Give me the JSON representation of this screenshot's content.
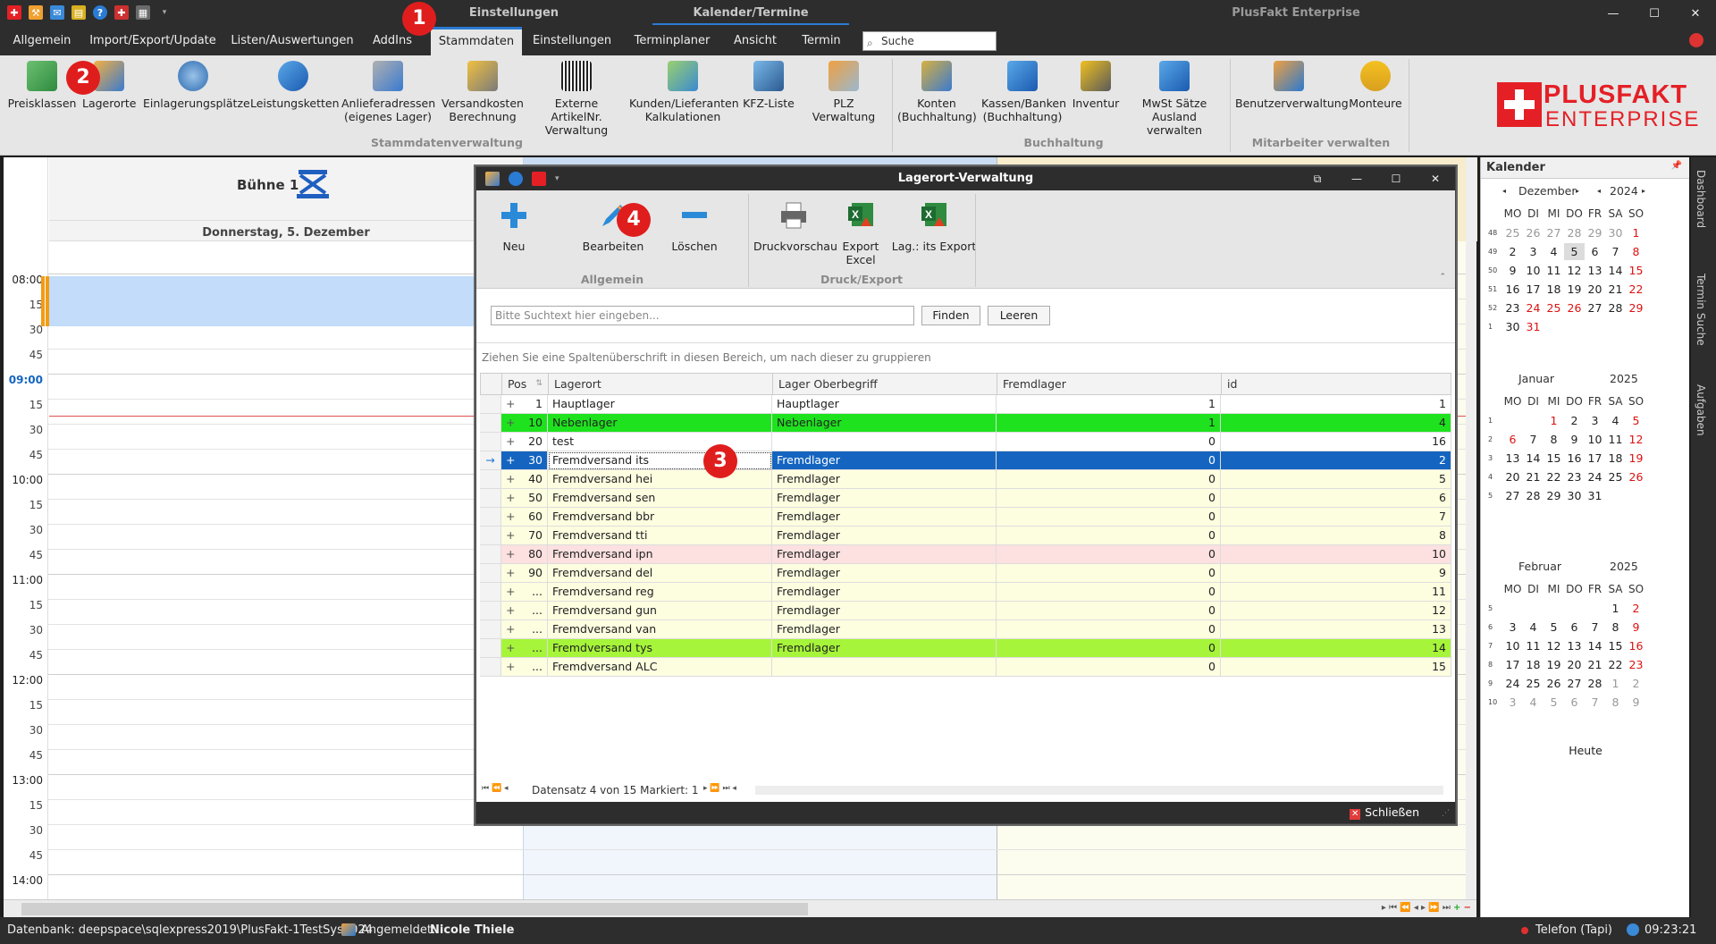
{
  "window": {
    "context_tab_1": "Einstellungen",
    "context_tab_2": "Kalender/Termine",
    "app_title": "PlusFakt Enterprise"
  },
  "menu": {
    "tabs": [
      "Allgemein",
      "Import/Export/Update",
      "Listen/Auswertungen",
      "AddIns",
      "Stammdaten",
      "Einstellungen",
      "Terminplaner",
      "Ansicht",
      "Termin"
    ],
    "active": "Stammdaten",
    "search_placeholder": "Suche"
  },
  "ribbon": {
    "buttons": [
      {
        "line1": "Preisklassen",
        "line2": ""
      },
      {
        "line1": "Lagerorte",
        "line2": ""
      },
      {
        "line1": "Einlagerungsplätze",
        "line2": ""
      },
      {
        "line1": "Leistungsketten",
        "line2": ""
      },
      {
        "line1": "Anlieferadressen",
        "line2": "(eigenes Lager)"
      },
      {
        "line1": "Versandkosten",
        "line2": "Berechnung"
      },
      {
        "line1": "Externe ArtikelNr.",
        "line2": "Verwaltung"
      },
      {
        "line1": "Kunden/Lieferanten",
        "line2": "Kalkulationen"
      },
      {
        "line1": "KFZ-Liste",
        "line2": ""
      },
      {
        "line1": "PLZ Verwaltung",
        "line2": ""
      },
      {
        "line1": "Konten",
        "line2": "(Buchhaltung)"
      },
      {
        "line1": "Kassen/Banken",
        "line2": "(Buchhaltung)"
      },
      {
        "line1": "Inventur",
        "line2": ""
      },
      {
        "line1": "MwSt Sätze",
        "line2": "Ausland verwalten"
      },
      {
        "line1": "Benutzerverwaltung",
        "line2": ""
      },
      {
        "line1": "Monteure",
        "line2": ""
      }
    ],
    "groups": [
      "Stammdatenverwaltung",
      "Buchhaltung",
      "Mitarbeiter verwalten"
    ],
    "logo_line1": "PLUSFAKT",
    "logo_line2": "ENTERPRISE"
  },
  "calendar": {
    "resource": "Bühne 1",
    "date": "Donnerstag, 5. Dezember",
    "times": [
      "08:00",
      "15",
      "30",
      "45",
      "09:00",
      "15",
      "30",
      "45",
      "10:00",
      "15",
      "30",
      "45",
      "11:00",
      "15",
      "30",
      "45",
      "12:00",
      "15",
      "30",
      "45",
      "13:00",
      "15",
      "30",
      "45",
      "14:00"
    ]
  },
  "side_calendar": {
    "title": "Kalender",
    "weekdays": [
      "MO",
      "DI",
      "MI",
      "DO",
      "FR",
      "SA",
      "SO"
    ],
    "today_button": "Heute",
    "months": [
      {
        "month": "Dezember",
        "year": "2024",
        "weeks": [
          {
            "wk": "48",
            "days": [
              "25",
              "26",
              "27",
              "28",
              "29",
              "30",
              "1"
            ]
          },
          {
            "wk": "49",
            "days": [
              "2",
              "3",
              "4",
              "5",
              "6",
              "7",
              "8"
            ]
          },
          {
            "wk": "50",
            "days": [
              "9",
              "10",
              "11",
              "12",
              "13",
              "14",
              "15"
            ]
          },
          {
            "wk": "51",
            "days": [
              "16",
              "17",
              "18",
              "19",
              "20",
              "21",
              "22"
            ]
          },
          {
            "wk": "52",
            "days": [
              "23",
              "24",
              "25",
              "26",
              "27",
              "28",
              "29"
            ]
          },
          {
            "wk": "1",
            "days": [
              "30",
              "31",
              "",
              "",
              "",
              "",
              ""
            ]
          }
        ]
      },
      {
        "month": "Januar",
        "year": "2025",
        "weeks": [
          {
            "wk": "1",
            "days": [
              "",
              "",
              "1",
              "2",
              "3",
              "4",
              "5"
            ]
          },
          {
            "wk": "2",
            "days": [
              "6",
              "7",
              "8",
              "9",
              "10",
              "11",
              "12"
            ]
          },
          {
            "wk": "3",
            "days": [
              "13",
              "14",
              "15",
              "16",
              "17",
              "18",
              "19"
            ]
          },
          {
            "wk": "4",
            "days": [
              "20",
              "21",
              "22",
              "23",
              "24",
              "25",
              "26"
            ]
          },
          {
            "wk": "5",
            "days": [
              "27",
              "28",
              "29",
              "30",
              "31",
              "",
              ""
            ]
          }
        ]
      },
      {
        "month": "Februar",
        "year": "2025",
        "weeks": [
          {
            "wk": "5",
            "days": [
              "",
              "",
              "",
              "",
              "",
              "1",
              "2"
            ]
          },
          {
            "wk": "6",
            "days": [
              "3",
              "4",
              "5",
              "6",
              "7",
              "8",
              "9"
            ]
          },
          {
            "wk": "7",
            "days": [
              "10",
              "11",
              "12",
              "13",
              "14",
              "15",
              "16"
            ]
          },
          {
            "wk": "8",
            "days": [
              "17",
              "18",
              "19",
              "20",
              "21",
              "22",
              "23"
            ]
          },
          {
            "wk": "9",
            "days": [
              "24",
              "25",
              "26",
              "27",
              "28",
              "1",
              "2"
            ]
          },
          {
            "wk": "10",
            "days": [
              "3",
              "4",
              "5",
              "6",
              "7",
              "8",
              "9"
            ]
          }
        ]
      }
    ]
  },
  "side_tabs": [
    "Dashboard",
    "Termin Suche",
    "Aufgaben"
  ],
  "dialog": {
    "title": "Lagerort-Verwaltung",
    "buttons": [
      {
        "line1": "Neu",
        "line2": ""
      },
      {
        "line1": "Bearbeiten",
        "line2": ""
      },
      {
        "line1": "Löschen",
        "line2": ""
      },
      {
        "line1": "Druckvorschau",
        "line2": ""
      },
      {
        "line1": "Export",
        "line2": "Excel"
      },
      {
        "line1": "Lag.: its Export",
        "line2": ""
      }
    ],
    "groups": [
      "Allgemein",
      "Druck/Export"
    ],
    "search_placeholder": "Bitte Suchtext hier eingeben...",
    "find_label": "Finden",
    "clear_label": "Leeren",
    "group_hint": "Ziehen Sie eine Spaltenüberschrift in diesen Bereich, um nach dieser zu gruppieren",
    "columns": [
      "Pos",
      "Lagerort",
      "Lager Oberbegriff",
      "Fremdlager",
      "id"
    ],
    "rows": [
      {
        "pos": "1",
        "lagerort": "Hauptlager",
        "ober": "Hauptlager",
        "fremd": "1",
        "id": "1",
        "bg": "#ffffff"
      },
      {
        "pos": "10",
        "lagerort": "Nebenlager",
        "ober": "Nebenlager",
        "fremd": "1",
        "id": "4",
        "bg": "#1ee21e"
      },
      {
        "pos": "20",
        "lagerort": "test",
        "ober": "",
        "fremd": "0",
        "id": "16",
        "bg": "#ffffff"
      },
      {
        "pos": "30",
        "lagerort": "Fremdversand its",
        "ober": "Fremdlager",
        "fremd": "0",
        "id": "2",
        "bg": "#1565c0"
      },
      {
        "pos": "40",
        "lagerort": "Fremdversand hei",
        "ober": "Fremdlager",
        "fremd": "0",
        "id": "5",
        "bg": "#fdfde0"
      },
      {
        "pos": "50",
        "lagerort": "Fremdversand sen",
        "ober": "Fremdlager",
        "fremd": "0",
        "id": "6",
        "bg": "#fdfde0"
      },
      {
        "pos": "60",
        "lagerort": "Fremdversand bbr",
        "ober": "Fremdlager",
        "fremd": "0",
        "id": "7",
        "bg": "#fdfde0"
      },
      {
        "pos": "70",
        "lagerort": "Fremdversand tti",
        "ober": "Fremdlager",
        "fremd": "0",
        "id": "8",
        "bg": "#fdfde0"
      },
      {
        "pos": "80",
        "lagerort": "Fremdversand ipn",
        "ober": "Fremdlager",
        "fremd": "0",
        "id": "10",
        "bg": "#fde0e0"
      },
      {
        "pos": "90",
        "lagerort": "Fremdversand del",
        "ober": "Fremdlager",
        "fremd": "0",
        "id": "9",
        "bg": "#fdfde0"
      },
      {
        "pos": "...",
        "lagerort": "Fremdversand reg",
        "ober": "Fremdlager",
        "fremd": "0",
        "id": "11",
        "bg": "#fdfde0"
      },
      {
        "pos": "...",
        "lagerort": "Fremdversand gun",
        "ober": "Fremdlager",
        "fremd": "0",
        "id": "12",
        "bg": "#fdfde0"
      },
      {
        "pos": "...",
        "lagerort": "Fremdversand van",
        "ober": "Fremdlager",
        "fremd": "0",
        "id": "13",
        "bg": "#fdfde0"
      },
      {
        "pos": "...",
        "lagerort": "Fremdversand tys",
        "ober": "Fremdlager",
        "fremd": "0",
        "id": "14",
        "bg": "#a6f53a"
      },
      {
        "pos": "...",
        "lagerort": "Fremdversand ALC",
        "ober": "",
        "fremd": "0",
        "id": "15",
        "bg": "#fdfde0"
      }
    ],
    "selected_row": 3,
    "pager_text": "Datensatz 4 von 15 Markiert: 1",
    "close_label": "Schließen"
  },
  "status": {
    "database": "Datenbank: deepspace\\sqlexpress2019\\PlusFakt-1TestSys2024",
    "user_label": "Angemeldet:",
    "user_name": "Nicole Thiele",
    "phone": "Telefon (Tapi)",
    "time": "09:23:21"
  },
  "badges": [
    "1",
    "2",
    "3",
    "4"
  ],
  "colors": {
    "accent": "#2a7bd4",
    "brand_red": "#e42026",
    "selection": "#1565c0",
    "badge": "#e01d1d"
  }
}
